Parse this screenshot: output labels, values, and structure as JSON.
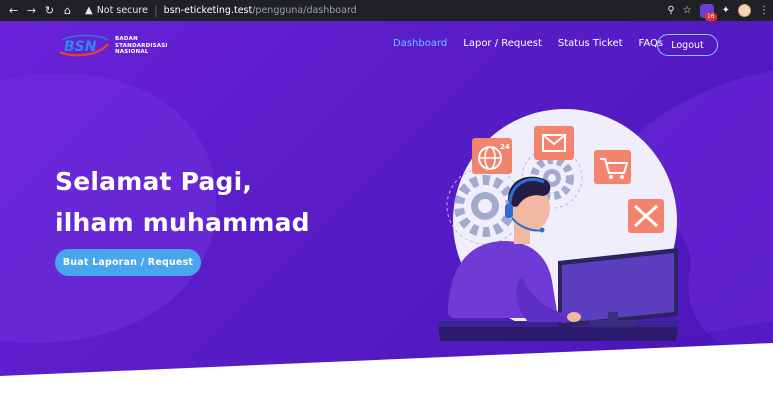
{
  "browser": {
    "security_label": "Not secure",
    "url_host": "bsn-eticketing.test",
    "url_path": "/pengguna/dashboard",
    "extension_badge": "16"
  },
  "header": {
    "logo_abbr": "BSN",
    "logo_line1": "BADAN",
    "logo_line2": "STANDARDISASI",
    "logo_line3": "NASIONAL",
    "nav": [
      {
        "label": "Dashboard",
        "active": true
      },
      {
        "label": "Lapor / Request",
        "active": false
      },
      {
        "label": "Status Ticket",
        "active": false
      },
      {
        "label": "FAQs",
        "active": false
      }
    ],
    "logout_label": "Logout"
  },
  "hero": {
    "greeting_line1": "Selamat Pagi,",
    "greeting_line2": "ilham muhammad",
    "cta_label": "Buat Laporan / Request",
    "illustration_badge": "24"
  },
  "colors": {
    "hero_bg": "#5a1dc9",
    "nav_active": "#6ec1ff",
    "cta": "#47a6ec",
    "logout_border": "#7fc8ff",
    "icon_tile": "#f2846d"
  },
  "icons": [
    "back-arrow-icon",
    "forward-arrow-icon",
    "reload-icon",
    "home-icon",
    "warning-icon",
    "key-icon",
    "star-icon",
    "extension-icon",
    "puzzle-icon",
    "profile-icon",
    "menu-icon",
    "globe-icon",
    "mail-icon",
    "cart-icon",
    "tools-icon"
  ]
}
